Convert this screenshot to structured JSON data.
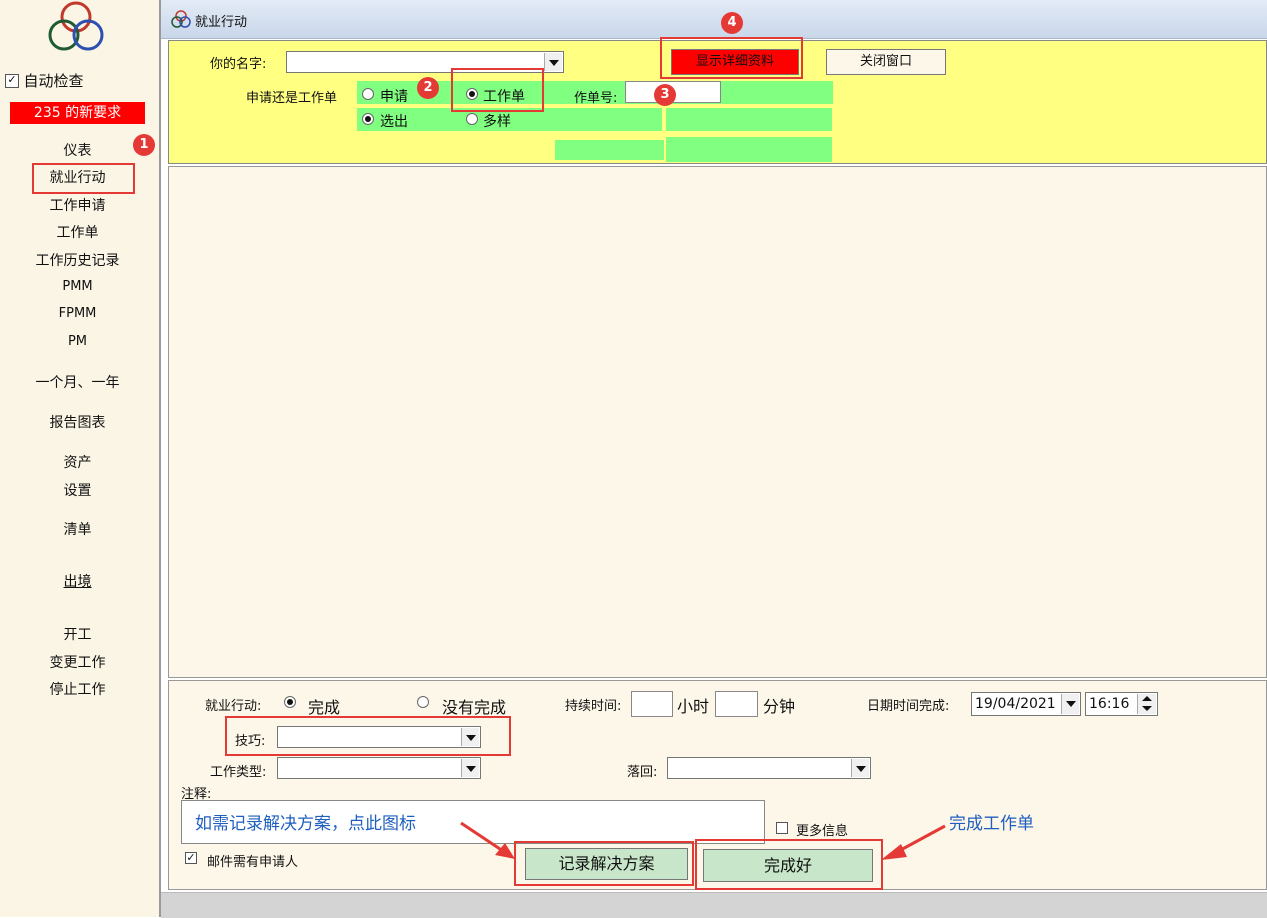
{
  "sidebar": {
    "auto_check_label": "自动检查",
    "new_requests": "235 的新要求",
    "items": [
      "仪表",
      "就业行动",
      "工作申请",
      "工作单",
      "工作历史记录",
      "PMM",
      "FPMM",
      "PM",
      "一个月、一年",
      "报告图表",
      "资产",
      "设置",
      "清单",
      "出境",
      "开工",
      "变更工作",
      "停止工作"
    ]
  },
  "window": {
    "title": "就业行动"
  },
  "top_panel": {
    "name_label": "你的名字:",
    "name_value": "",
    "request_or_workorder_label": "申请还是工作单",
    "radio_request": "申请",
    "radio_workorder": "工作单",
    "workorder_no_label": "作单号:",
    "workorder_no_value": "",
    "radio_selected": "选出",
    "radio_multiple": "多样",
    "show_details_button": "显示详细资料",
    "close_window_button": "关闭窗口"
  },
  "bottom_panel": {
    "action_label": "就业行动:",
    "radio_done": "完成",
    "radio_not_done": "没有完成",
    "duration_label": "持续时间:",
    "hours_value": "",
    "hours_label": "小时",
    "minutes_value": "",
    "minutes_label": "分钟",
    "date_done_label": "日期时间完成:",
    "date_value": "19/04/2021",
    "time_value": "16:16",
    "skill_label": "技巧:",
    "skill_value": "",
    "work_type_label": "工作类型:",
    "work_type_value": "",
    "fallback_label": "落回:",
    "fallback_value": "",
    "notes_label": "注释:",
    "notes_hint": "如需记录解决方案，点此图标",
    "more_info_label": "更多信息",
    "email_requester_label": "邮件需有申请人",
    "record_solution_button": "记录解决方案",
    "complete_button": "完成好",
    "complete_workorder_annotation": "完成工作单"
  },
  "annotations": {
    "badges": [
      "1",
      "2",
      "3",
      "4"
    ]
  },
  "colors": {
    "red": "#ff0000",
    "green": "#80ff80",
    "yellow": "#ffff82",
    "annotation_red": "#e53935",
    "annotation_blue": "#1f5fbf"
  }
}
